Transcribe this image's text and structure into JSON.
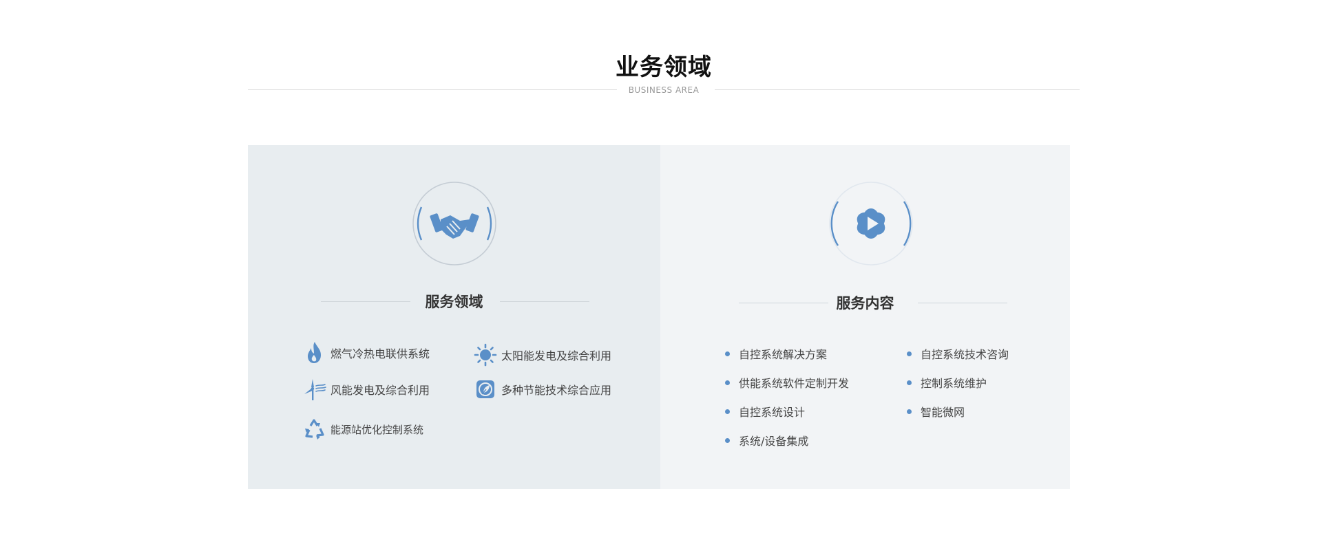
{
  "section": {
    "title": "业务领域",
    "subtitle": "BUSINESS AREA"
  },
  "colors": {
    "accent": "#5a8fc8",
    "left_panel_bg": "#e8edf0",
    "right_panel_bg": "#f2f4f6"
  },
  "left_panel": {
    "icon": "handshake-icon",
    "title": "服务领域",
    "items": [
      {
        "label": "燃气冷热电联供系统",
        "icon": "flame-icon"
      },
      {
        "label": "太阳能发电及综合利用",
        "icon": "sun-icon"
      },
      {
        "label": "风能发电及综合利用",
        "icon": "wind-turbine-icon"
      },
      {
        "label": "多种节能技术综合应用",
        "icon": "energy-saving-icon"
      },
      {
        "label": "能源站优化控制系统",
        "icon": "recycle-icon"
      }
    ]
  },
  "right_panel": {
    "icon": "play-orb-icon",
    "title": "服务内容",
    "items": [
      {
        "label": "自控系统解决方案"
      },
      {
        "label": "自控系统技术咨询"
      },
      {
        "label": "供能系统软件定制开发"
      },
      {
        "label": "控制系统维护"
      },
      {
        "label": "自控系统设计"
      },
      {
        "label": "智能微网"
      },
      {
        "label": "系统/设备集成"
      }
    ]
  }
}
